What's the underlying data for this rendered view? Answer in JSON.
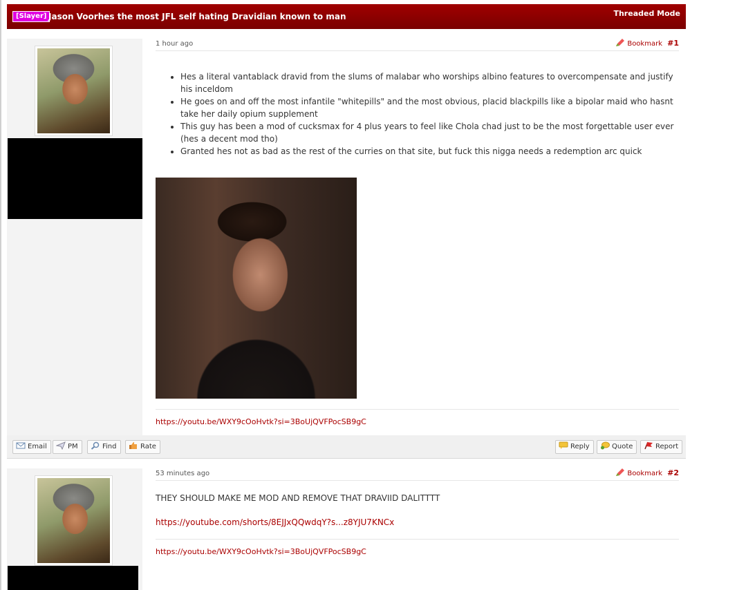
{
  "thread": {
    "prefix": "[Slayer]",
    "title": "Jason Voorhes the most JFL self hating Dravidian known to man",
    "mode_label": "Threaded Mode"
  },
  "posts": [
    {
      "date": "1 hour ago",
      "bookmark_label": "Bookmark",
      "number": "#1",
      "bullets": [
        "Hes a literal vantablack dravid from the slums of malabar who worships albino features to overcompensate and justify his inceldom",
        "He goes on and off the most infantile \"whitepills\" and the most obvious, placid blackpills like a bipolar maid who hasnt take her daily opium supplement",
        "This guy has been a mod of cucksmax for 4 plus years to feel like Chola chad just to be the most forgettable user ever (hes a decent mod tho)",
        "Granted hes not as bad as the rest of the curries on that site, but fuck this nigga needs a redemption arc quick"
      ],
      "signature_link": "https://youtu.be/WXY9cOoHvtk?si=3BoUjQVFPocSB9gC"
    },
    {
      "date": "53 minutes ago",
      "bookmark_label": "Bookmark",
      "number": "#2",
      "text": "THEY SHOULD MAKE ME MOD AND REMOVE THAT DRAVIID DALITTTT",
      "link": "https://youtube.com/shorts/8EJJxQQwdqY?s...z8YJU7KNCx",
      "signature_link": "https://youtu.be/WXY9cOoHvtk?si=3BoUjQVFPocSB9gC"
    }
  ],
  "actions": {
    "email": "Email",
    "pm": "PM",
    "find": "Find",
    "rate": "Rate",
    "reply": "Reply",
    "quote": "Quote",
    "report": "Report"
  },
  "icons": {
    "bookmark": "pencil-icon",
    "email": "envelope-icon",
    "pm": "paper-plane-icon",
    "find": "magnifier-icon",
    "rate": "thumbs-up-icon",
    "reply": "speech-bubble-icon",
    "quote": "quote-bubble-icon",
    "report": "flag-icon"
  },
  "colors": {
    "header_bg": "#8b0000",
    "prefix_bg": "#e000e0",
    "link": "#aa0000"
  }
}
